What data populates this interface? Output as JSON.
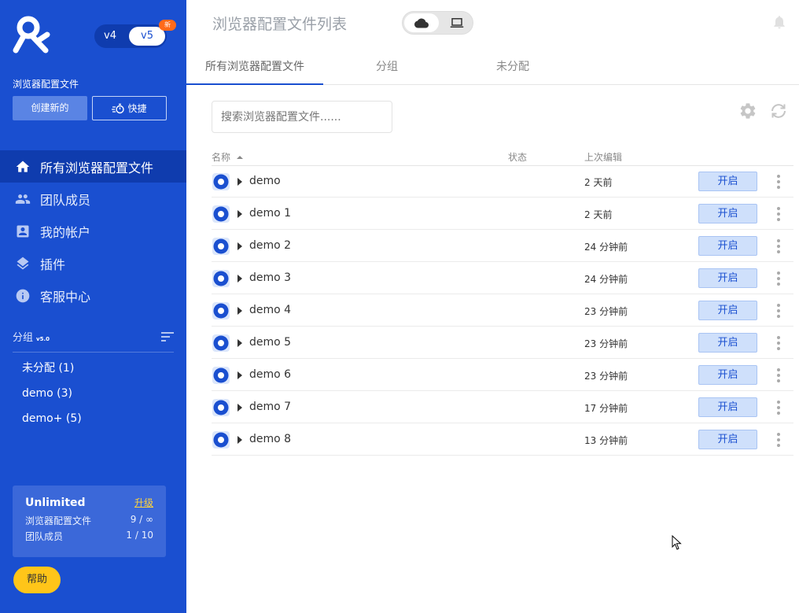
{
  "sidebar": {
    "version_toggle": {
      "v4": "v4",
      "v5": "v5",
      "badge": "新"
    },
    "section_label": "浏览器配置文件",
    "create_button": "创建新的",
    "quick_button": "快捷",
    "nav": [
      {
        "label": "所有浏览器配置文件",
        "icon": "home-icon",
        "active": true
      },
      {
        "label": "团队成员",
        "icon": "people-icon",
        "active": false
      },
      {
        "label": "我的帐户",
        "icon": "account-icon",
        "active": false
      },
      {
        "label": "插件",
        "icon": "layers-icon",
        "active": false
      },
      {
        "label": "客服中心",
        "icon": "info-icon",
        "active": false
      }
    ],
    "groups": {
      "title": "分组",
      "version": "v5.0",
      "items": [
        "未分配 (1)",
        "demo (3)",
        "demo+ (5)"
      ]
    },
    "plan": {
      "name": "Unlimited",
      "upgrade": "升级",
      "rows": [
        {
          "label": "浏览器配置文件",
          "value": "9 / ∞"
        },
        {
          "label": "团队成员",
          "value": "1 / 10"
        }
      ]
    },
    "help_button": "帮助"
  },
  "header": {
    "title": "浏览器配置文件列表"
  },
  "tabs": [
    "所有浏览器配置文件",
    "分组",
    "未分配"
  ],
  "search": {
    "placeholder": "搜索浏览器配置文件......"
  },
  "table": {
    "columns": {
      "name": "名称",
      "status": "状态",
      "last_edit": "上次编辑"
    },
    "open_label": "开启",
    "rows": [
      {
        "name": "demo",
        "last_edit": "2 天前"
      },
      {
        "name": "demo 1",
        "last_edit": "2 天前"
      },
      {
        "name": "demo 2",
        "last_edit": "24 分钟前"
      },
      {
        "name": "demo 3",
        "last_edit": "24 分钟前"
      },
      {
        "name": "demo 4",
        "last_edit": "23 分钟前"
      },
      {
        "name": "demo 5",
        "last_edit": "23 分钟前"
      },
      {
        "name": "demo 6",
        "last_edit": "23 分钟前"
      },
      {
        "name": "demo 7",
        "last_edit": "17 分钟前"
      },
      {
        "name": "demo 8",
        "last_edit": "13 分钟前"
      }
    ]
  },
  "colors": {
    "sidebar_bg": "#1a4fd0",
    "sidebar_active": "#0f3cae",
    "accent_yellow": "#ffc519",
    "open_button_bg": "#cfe0fb"
  }
}
